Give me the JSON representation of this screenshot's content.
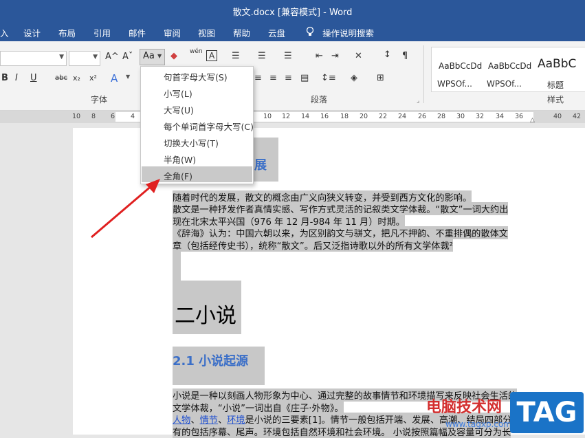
{
  "window": {
    "title": "散文.docx [兼容模式] - Word"
  },
  "tabs": [
    "入",
    "设计",
    "布局",
    "引用",
    "邮件",
    "审阅",
    "视图",
    "帮助",
    "云盘",
    "操作说明搜索"
  ],
  "ribbon": {
    "change_case_button": "Aa",
    "font_group_label": "字体",
    "paragraph_group_label": "段落",
    "styles_group_label": "样式",
    "font_buttons": {
      "bold": "B",
      "italic": "I",
      "underline": "U",
      "strike": "abc",
      "sub": "x₂",
      "sup": "x²",
      "grow": "A^",
      "shrink": "Aˇ"
    },
    "pinyin_label": "wén",
    "styles": [
      {
        "preview": "AaBbCcDd",
        "name": "WPSOf..."
      },
      {
        "preview": "AaBbCcDd",
        "name": "WPSOf..."
      },
      {
        "preview": "AaBbC",
        "name": "标题"
      }
    ]
  },
  "ruler": {
    "numbers": [
      "10",
      "8",
      "6",
      "4",
      "10",
      "12",
      "14",
      "16",
      "18",
      "20",
      "22",
      "24",
      "26",
      "28",
      "30",
      "32",
      "34",
      "36",
      "40",
      "42"
    ]
  },
  "case_menu": {
    "items": [
      {
        "label": "句首字母大写(S)",
        "selected": false
      },
      {
        "label": "小写(L)",
        "selected": false
      },
      {
        "label": "大写(U)",
        "selected": false
      },
      {
        "label": "每个单词首字母大写(C)",
        "selected": false
      },
      {
        "label": "切换大小写(T)",
        "selected": false
      },
      {
        "label": "半角(W)",
        "selected": false
      },
      {
        "label": "全角(F)",
        "selected": true
      }
    ]
  },
  "document": {
    "heading_partial": "展",
    "para1": [
      "随着时代的发展，散文的概念由广义向狭义转变，并受到西方文化的影响。",
      "散文是一种抒发作者真情实感、写作方式灵活的记叙类文学体裁。“散文”一词大约出",
      "现在北宋太平兴国（976 年 12 月-984 年 11 月）时期。",
      "《辞海》认为：中国六朝以来，为区别韵文与骈文，把凡不押韵、不重排偶的散体文",
      "章（包括经传史书），统称“散文”。后又泛指诗歌以外的所有文学体裁²"
    ],
    "heading1": "二小说",
    "heading2": "2.1 小说起源",
    "para2": [
      "小说是一种以刻画人物形象为中心、通过完整的故事情节和环境描写来反映社会生活的",
      "文学体裁，“小说”一词出自《庄子·外物》。"
    ],
    "para3_links": [
      "人物",
      "情节",
      "环境"
    ],
    "para3_sep": "、",
    "para3_rest": "是小说的三要素[1]。情节一般包括开端、发展、高潮、结局四部分",
    "para3_line2": "有的包括序幕、尾声。环境包括自然环境和社会环境。 小说按照篇幅及容量可分为长"
  },
  "watermark": {
    "cn": "电脑技术网",
    "tag": "TAG",
    "url": "www.tagxp.com"
  }
}
